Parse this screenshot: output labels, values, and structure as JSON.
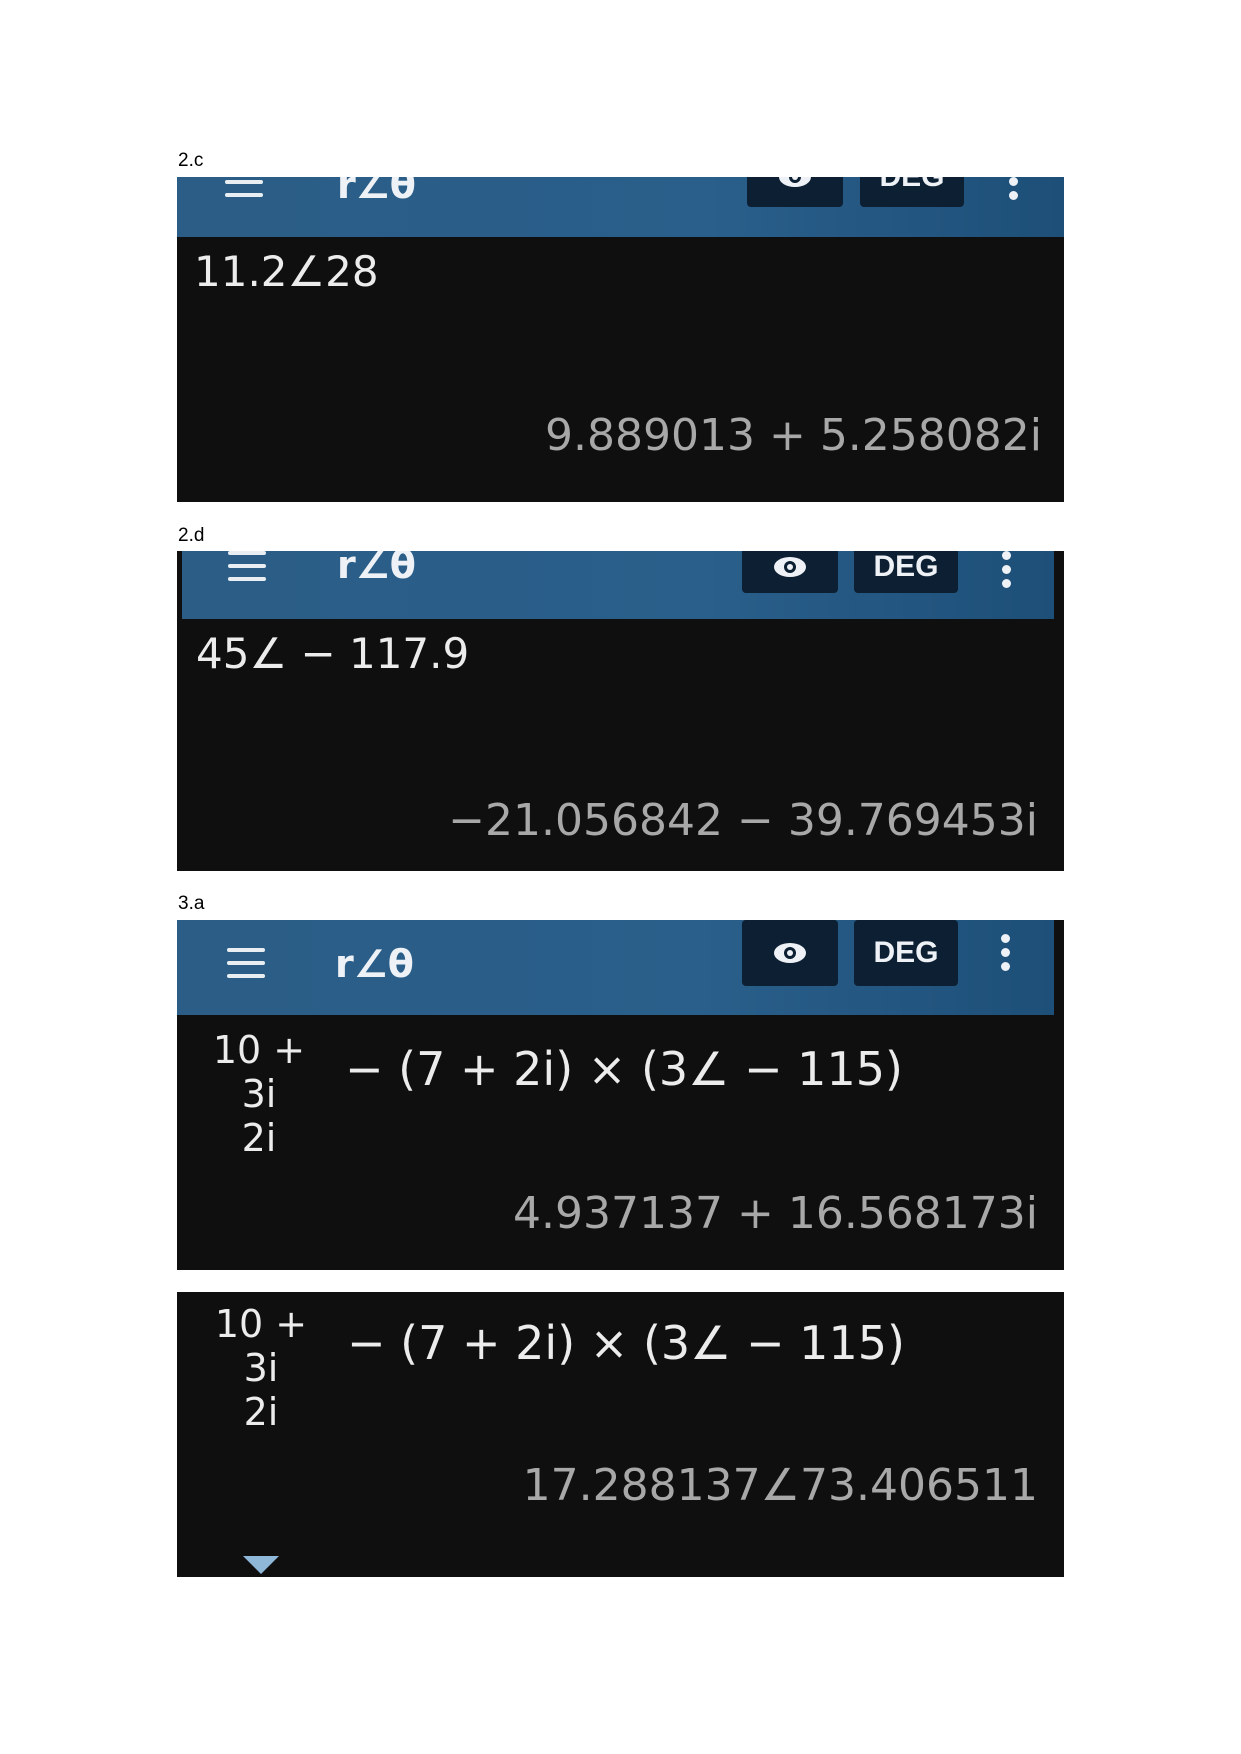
{
  "labels": [
    "2.c",
    "2.d",
    "3.a"
  ],
  "toolbar": {
    "mode": "r∠θ",
    "angle_unit": "DEG",
    "menu_icon": "hamburger-menu-icon",
    "eye_icon": "eye-icon",
    "more_icon": "more-vert-icon"
  },
  "screens": {
    "c": {
      "expression": "11.2∠28",
      "result": "9.889013 + 5.258082i"
    },
    "d": {
      "expression": "45∠ − 117.9",
      "result": "−21.056842 − 39.769453i"
    },
    "a1": {
      "numerator": "10 + 3i",
      "denominator": "2i",
      "rest": "− (7 + 2i) × (3∠ − 115)",
      "result": "4.937137 + 16.568173i"
    },
    "a2": {
      "numerator": "10 + 3i",
      "denominator": "2i",
      "rest": "− (7 + 2i) × (3∠ − 115)",
      "result": "17.288137∠73.406511"
    }
  },
  "colors": {
    "toolbar": "#2a5f8b",
    "screen_bg": "#0f0f10",
    "result_text": "#a8a8a8",
    "expand_arrow": "#8fb7d8"
  }
}
